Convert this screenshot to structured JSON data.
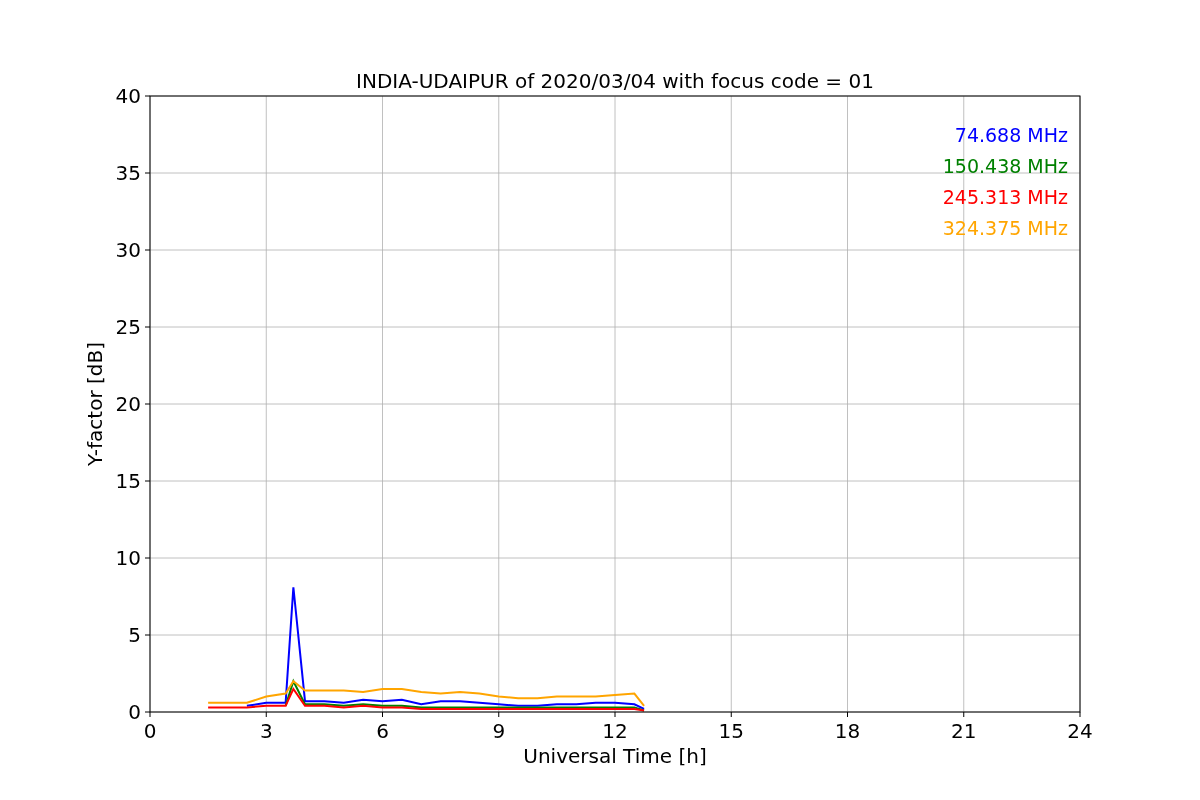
{
  "chart_data": {
    "type": "line",
    "title": "INDIA-UDAIPUR of 2020/03/04 with focus code = 01",
    "xlabel": "Universal Time [h]",
    "ylabel": "Y-factor [dB]",
    "x": [
      1.5,
      2,
      2.5,
      3,
      3.5,
      3.7,
      4,
      4.5,
      5,
      5.5,
      6,
      6.5,
      7,
      7.5,
      8,
      8.5,
      9,
      9.5,
      10,
      10.5,
      11,
      11.5,
      12,
      12.5,
      12.75
    ],
    "series": [
      {
        "name": "74.688 MHz",
        "color": "#0000ff",
        "values": [
          null,
          null,
          0.4,
          0.6,
          0.6,
          8.1,
          0.7,
          0.7,
          0.6,
          0.8,
          0.7,
          0.8,
          0.5,
          0.7,
          0.7,
          0.6,
          0.5,
          0.4,
          0.4,
          0.5,
          0.5,
          0.6,
          0.6,
          0.5,
          0.2
        ]
      },
      {
        "name": "150.438 MHz",
        "color": "#008000",
        "values": [
          null,
          null,
          null,
          null,
          0.4,
          2.0,
          0.5,
          0.5,
          0.4,
          0.5,
          0.4,
          0.4,
          0.3,
          0.3,
          0.3,
          0.3,
          0.3,
          0.3,
          0.3,
          0.3,
          0.3,
          0.3,
          0.3,
          0.3,
          0.1
        ]
      },
      {
        "name": "245.313 MHz",
        "color": "#ff0000",
        "values": [
          0.3,
          0.3,
          0.3,
          0.4,
          0.4,
          1.5,
          0.4,
          0.4,
          0.3,
          0.4,
          0.3,
          0.3,
          0.2,
          0.2,
          0.2,
          0.2,
          0.2,
          0.2,
          0.2,
          0.2,
          0.2,
          0.2,
          0.2,
          0.2,
          0.1
        ]
      },
      {
        "name": "324.375 MHz",
        "color": "#ffa500",
        "values": [
          0.6,
          0.6,
          0.6,
          1.0,
          1.2,
          2.0,
          1.4,
          1.4,
          1.4,
          1.3,
          1.5,
          1.5,
          1.3,
          1.2,
          1.3,
          1.2,
          1.0,
          0.9,
          0.9,
          1.0,
          1.0,
          1.0,
          1.1,
          1.2,
          0.4
        ]
      }
    ],
    "grid": true,
    "xlim": [
      0,
      24
    ],
    "ylim": [
      0,
      40
    ],
    "xticks": [
      0,
      3,
      6,
      9,
      12,
      15,
      18,
      21,
      24
    ],
    "yticks": [
      0,
      5,
      10,
      15,
      20,
      25,
      30,
      35,
      40
    ]
  }
}
